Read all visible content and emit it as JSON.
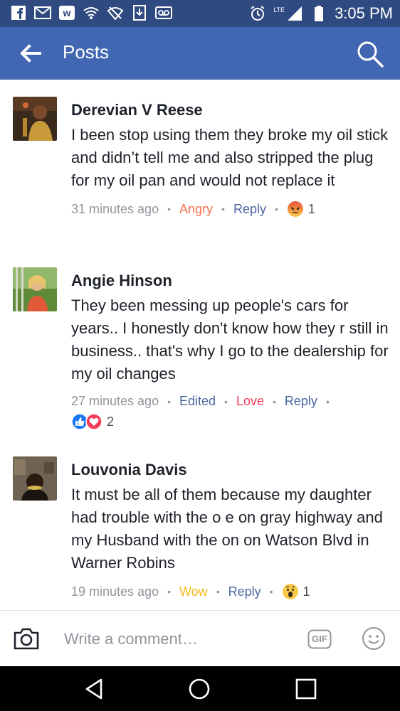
{
  "status_bar": {
    "time": "3:05 PM",
    "network": "LTE"
  },
  "header": {
    "title": "Posts"
  },
  "comments": [
    {
      "author": "Derevian V Reese",
      "text": "I been stop using them they broke my oil stick and didn’t tell me and also stripped the plug for my oil pan and would not replace it",
      "time": "31 minutes ago",
      "reaction_label": "Angry",
      "reaction_color": "#f7714c",
      "reply_label": "Reply",
      "reaction_count": "1"
    },
    {
      "author": "Angie Hinson",
      "text": "They been messing up people's cars for years.. I honestly don't know how they r still in business.. that's why I go to the dealership for my oil changes",
      "time": "27 minutes ago",
      "edited_label": "Edited",
      "reaction_label": "Love",
      "reaction_color": "#f33e58",
      "reply_label": "Reply",
      "reaction_count": "2"
    },
    {
      "author": "Louvonia Davis",
      "text": "It must be all of them because my daughter had trouble with the o e on gray highway and my Husband with the on on Watson Blvd in Warner Robins",
      "time": "19 minutes ago",
      "reaction_label": "Wow",
      "reaction_color": "#f0ba15",
      "reply_label": "Reply",
      "reaction_count": "1"
    }
  ],
  "composer": {
    "placeholder": "Write a comment…",
    "gif_label": "GIF"
  },
  "colors": {
    "header": "#4267b2",
    "status_bar": "#2f4a80",
    "link": "#4b67a1"
  }
}
